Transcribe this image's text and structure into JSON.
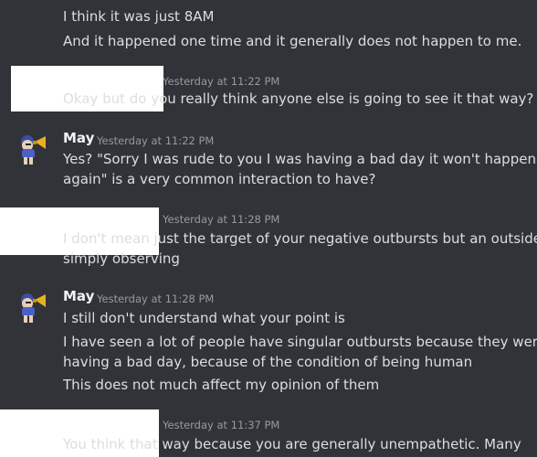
{
  "messages": [
    {
      "lines": [
        "I think it was just 8AM",
        "And it happened one time and it generally does not happen to me."
      ]
    },
    {
      "timestamp": "Yesterday at 11:22 PM",
      "lines": [
        "Okay but do you really think anyone else is going to see it that way?"
      ]
    },
    {
      "author": "May",
      "timestamp": "Yesterday at 11:22 PM",
      "lines": [
        "Yes? \"Sorry I was rude to you I was having a bad day it won't happen",
        "again\" is a very common interaction to have?"
      ]
    },
    {
      "timestamp": "Yesterday at 11:28 PM",
      "lines": [
        "I don't mean just the target of your negative outbursts but an outsider",
        "simply observing"
      ]
    },
    {
      "author": "May",
      "timestamp": "Yesterday at 11:28 PM",
      "lines": [
        "I still don't understand what your point is",
        "I have seen a lot of people have singular outbursts because they were",
        "having a bad day, because of the condition of being human",
        "This does not much affect my opinion of them"
      ]
    },
    {
      "timestamp": "Yesterday at 11:37 PM",
      "lines": [
        "You think that way because you are generally unempathetic. Many"
      ]
    }
  ]
}
